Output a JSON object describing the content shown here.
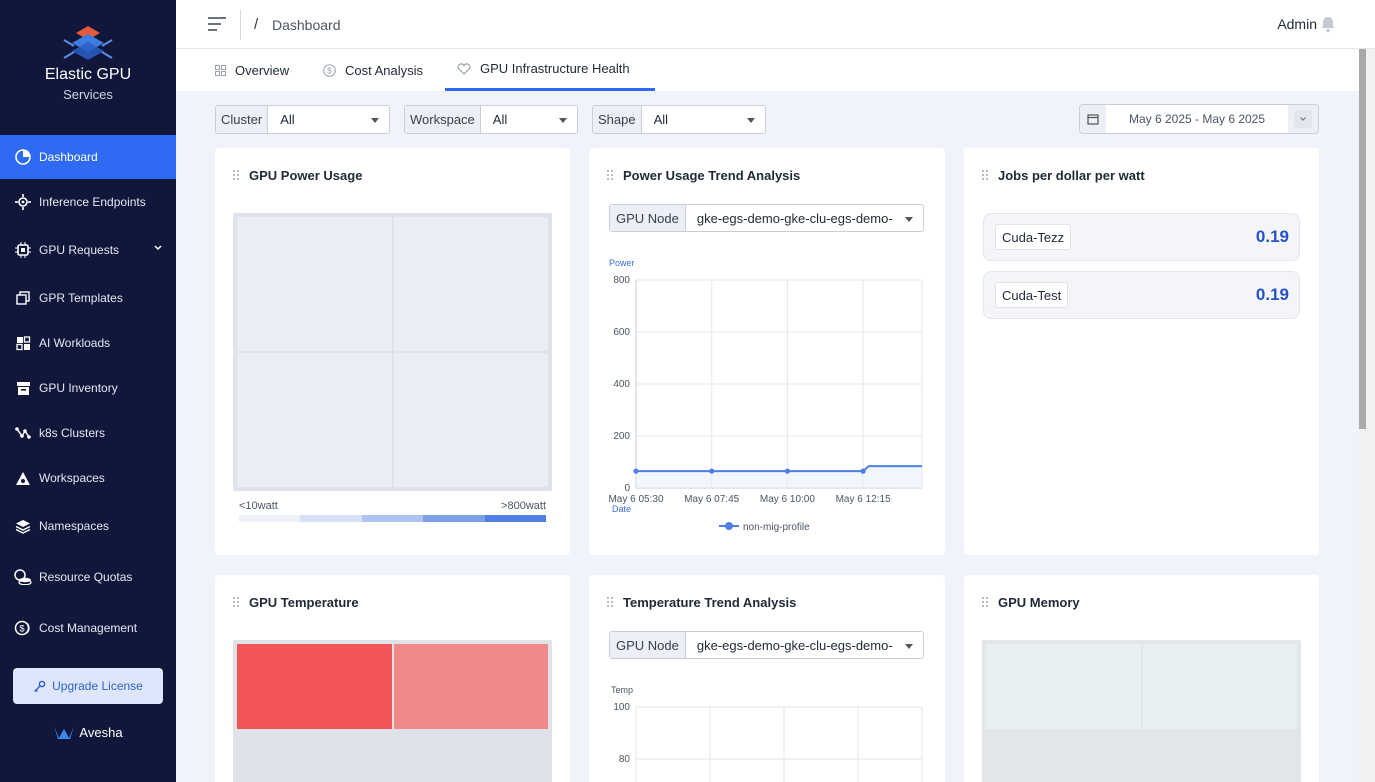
{
  "brand": {
    "name": "Elastic GPU",
    "sub": "Services"
  },
  "sidebar": {
    "items": [
      {
        "label": "Dashboard",
        "icon": "pie-chart-icon",
        "active": true
      },
      {
        "label": "Inference Endpoints",
        "icon": "gear-network-icon"
      },
      {
        "label": "GPU Requests",
        "icon": "chip-icon",
        "has_children": true
      },
      {
        "label": "GPR Templates",
        "icon": "copy-icon"
      },
      {
        "label": "AI Workloads",
        "icon": "grid-icon"
      },
      {
        "label": "GPU Inventory",
        "icon": "archive-icon"
      },
      {
        "label": "k8s Clusters",
        "icon": "cluster-icon"
      },
      {
        "label": "Workspaces",
        "icon": "workspace-icon"
      },
      {
        "label": "Namespaces",
        "icon": "layers-icon"
      },
      {
        "label": "Resource Quotas",
        "icon": "coins-icon"
      },
      {
        "label": "Cost Management",
        "icon": "money-icon"
      }
    ],
    "upgrade_label": "Upgrade License",
    "footer_logo": "Avesha"
  },
  "header": {
    "breadcrumb_sep": "/",
    "breadcrumb": "Dashboard",
    "user": "Admin"
  },
  "tabs": [
    {
      "label": "Overview",
      "icon": "grid-icon"
    },
    {
      "label": "Cost Analysis",
      "icon": "dollar-icon"
    },
    {
      "label": "GPU Infrastructure Health",
      "icon": "heart-icon",
      "active": true
    }
  ],
  "filters": [
    {
      "label": "Cluster",
      "value": "All"
    },
    {
      "label": "Workspace",
      "value": "All"
    },
    {
      "label": "Shape",
      "value": "All"
    }
  ],
  "date_range": "May 6 2025 - May 6 2025",
  "cards": {
    "power_usage": {
      "title": "GPU Power Usage",
      "legend_min": "<10watt",
      "legend_max": ">800watt",
      "legend_colors": [
        "#eef1f8",
        "#d7e1f6",
        "#aec3ef",
        "#7d9fe8",
        "#4f7ee5"
      ]
    },
    "power_trend": {
      "title": "Power Usage Trend Analysis",
      "node_label": "GPU Node",
      "node_value": "gke-egs-demo-gke-clu-egs-demo-"
    },
    "jobs": {
      "title": "Jobs per dollar per watt",
      "rows": [
        {
          "name": "Cuda-Tezz",
          "value": "0.19"
        },
        {
          "name": "Cuda-Test",
          "value": "0.19"
        }
      ]
    },
    "temperature": {
      "title": "GPU Temperature",
      "cell_colors": [
        "#f25555",
        "#f08a88"
      ]
    },
    "temp_trend": {
      "title": "Temperature Trend Analysis",
      "node_label": "GPU Node",
      "node_value": "gke-egs-demo-gke-clu-egs-demo-"
    },
    "memory": {
      "title": "GPU Memory"
    }
  },
  "chart_data": [
    {
      "type": "line",
      "ylabel": "Power",
      "xlabel": "Date",
      "ylim": [
        0,
        800
      ],
      "yticks": [
        800,
        600,
        400,
        200,
        0
      ],
      "xticks": [
        "May 6 05:30",
        "May 6 07:45",
        "May 6 10:00",
        "May 6 12:15"
      ],
      "series": [
        {
          "name": "non-mig-profile",
          "color": "#4f7ee5",
          "points": [
            [
              "05:30",
              65
            ],
            [
              "07:45",
              65
            ],
            [
              "10:00",
              65
            ],
            [
              "12:15",
              65
            ],
            [
              "12:25",
              84
            ],
            [
              "14:00",
              84
            ]
          ]
        }
      ],
      "grid": true,
      "legend": "bottom"
    },
    {
      "type": "line",
      "ylabel": "Temp",
      "ylim": [
        60,
        100
      ],
      "yticks": [
        100,
        80
      ],
      "grid": true
    }
  ]
}
